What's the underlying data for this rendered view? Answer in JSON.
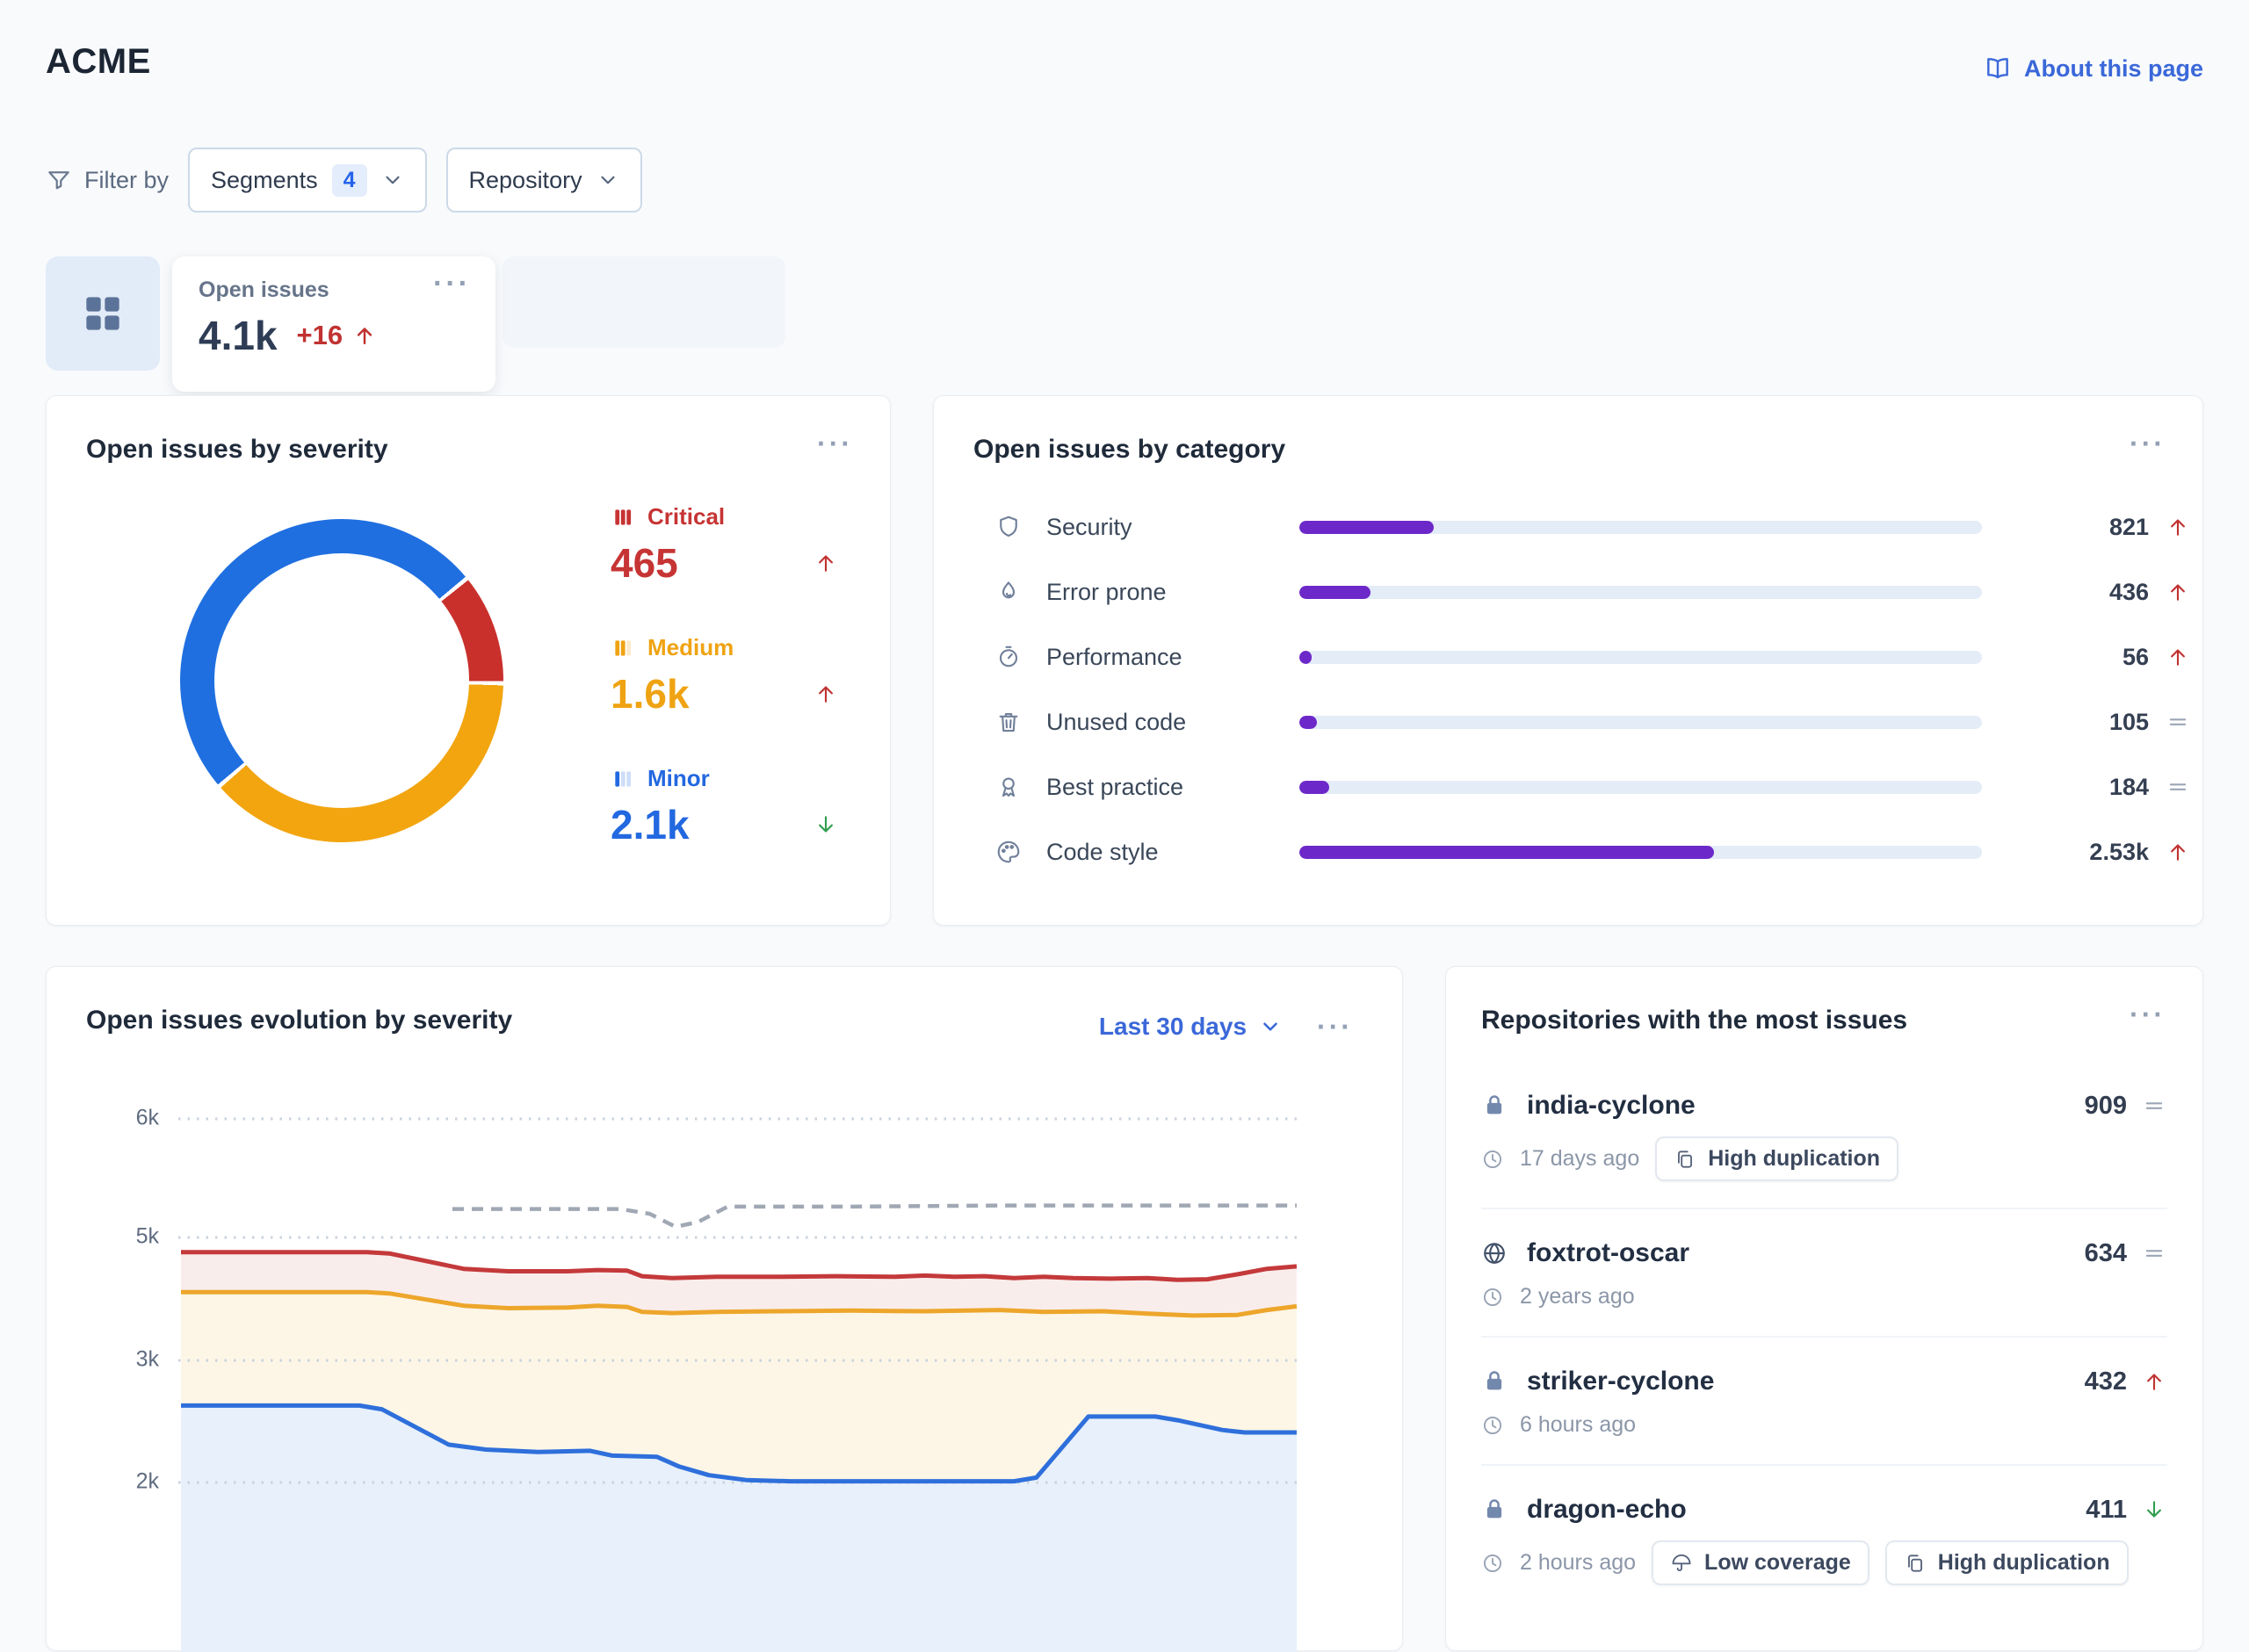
{
  "header": {
    "title": "ACME",
    "about_label": "About this page"
  },
  "icons_glyphs": {
    "more_menu": "···"
  },
  "colors": {
    "accent_blue": "#3b68d9",
    "purple_bar": "#6d28c9",
    "bar_track": "#e3ecf7",
    "critical_red": "#c63434",
    "medium_orange": "#efa312",
    "minor_blue": "#2268e0",
    "trend_up_red": "#c03231",
    "trend_down_green": "#2f9e4f",
    "trend_flat_gray": "#9aa5b5",
    "donut_blue": "#1f6fe0",
    "donut_red": "#c9302c",
    "donut_orange": "#f2a50f"
  },
  "filter": {
    "label": "Filter by",
    "segments_label": "Segments",
    "segments_count": "4",
    "repository_label": "Repository"
  },
  "metrics_strip": {
    "card": {
      "label": "Open issues",
      "value": "4.1k",
      "delta": "+16",
      "trend": "up"
    }
  },
  "severity_card": {
    "title": "Open issues by severity",
    "items": [
      {
        "label": "Critical",
        "value": "465",
        "trend": "up",
        "color": "#c63434",
        "icon": "severity-critical"
      },
      {
        "label": "Medium",
        "value": "1.6k",
        "trend": "up",
        "color": "#efa312",
        "icon": "severity-medium"
      },
      {
        "label": "Minor",
        "value": "2.1k",
        "trend": "down",
        "color": "#2268e0",
        "icon": "severity-minor"
      }
    ]
  },
  "category_card": {
    "title": "Open issues by category",
    "rows": [
      {
        "icon": "shield",
        "label": "Security",
        "value": "821",
        "trend": "up"
      },
      {
        "icon": "flame",
        "label": "Error prone",
        "value": "436",
        "trend": "up"
      },
      {
        "icon": "stopwatch",
        "label": "Performance",
        "value": "56",
        "trend": "up"
      },
      {
        "icon": "trash",
        "label": "Unused code",
        "value": "105",
        "trend": "flat"
      },
      {
        "icon": "medal",
        "label": "Best practice",
        "value": "184",
        "trend": "flat"
      },
      {
        "icon": "palette",
        "label": "Code style",
        "value": "2.53k",
        "trend": "up"
      }
    ]
  },
  "evolution_card": {
    "title": "Open issues evolution by severity",
    "range_label": "Last 30 days"
  },
  "repos_card": {
    "title": "Repositories with the most issues",
    "rows": [
      {
        "icon": "lock",
        "name": "india-cyclone",
        "value": "909",
        "trend": "flat",
        "updated": "17 days ago",
        "badges": [
          {
            "icon": "copy",
            "label": "High duplication"
          }
        ]
      },
      {
        "icon": "globe",
        "name": "foxtrot-oscar",
        "value": "634",
        "trend": "flat",
        "updated": "2 years ago",
        "badges": []
      },
      {
        "icon": "lock",
        "name": "striker-cyclone",
        "value": "432",
        "trend": "up",
        "updated": "6 hours ago",
        "badges": []
      },
      {
        "icon": "lock",
        "name": "dragon-echo",
        "value": "411",
        "trend": "down",
        "updated": "2 hours ago",
        "badges": [
          {
            "icon": "umbrella",
            "label": "Low coverage"
          },
          {
            "icon": "copy",
            "label": "High duplication"
          }
        ]
      }
    ]
  },
  "chart_data": [
    {
      "type": "pie",
      "donut": true,
      "title": "Open issues by severity",
      "labels": [
        "Critical",
        "Medium",
        "Minor"
      ],
      "values": [
        465,
        1600,
        2100
      ],
      "display_values": [
        "465",
        "1.6k",
        "2.1k"
      ],
      "colors": [
        "#c9302c",
        "#f2a50f",
        "#1f6fe0"
      ],
      "trends": [
        "up",
        "up",
        "down"
      ],
      "draw_order_from_230deg_clockwise": [
        "Minor",
        "Critical",
        "Medium"
      ],
      "segment_gap_deg": 1.5
    },
    {
      "type": "bar",
      "orientation": "horizontal",
      "title": "Open issues by category",
      "categories": [
        "Security",
        "Error prone",
        "Performance",
        "Unused code",
        "Best practice",
        "Code style"
      ],
      "values": [
        821,
        436,
        56,
        105,
        184,
        2530
      ],
      "display_values": [
        "821",
        "436",
        "56",
        "105",
        "184",
        "2.53k"
      ],
      "trends": [
        "up",
        "up",
        "up",
        "flat",
        "flat",
        "up"
      ],
      "scale_total": 4165,
      "bar_color": "#6d28c9",
      "track_color": "#e3ecf7",
      "grid": false
    },
    {
      "type": "area",
      "title": "Open issues evolution by severity",
      "x_unit": "days ago (0 = 30 days ago, 30 = today)",
      "x_range": [
        0,
        30
      ],
      "range_label": "Last 30 days",
      "yticks": [
        {
          "label": "6k",
          "value": 6
        },
        {
          "label": "5k",
          "value": 5
        },
        {
          "label": "3k",
          "value": 3
        },
        {
          "label": "2k",
          "value": 2
        }
      ],
      "grid": "dotted",
      "series": [
        {
          "name": "total-threshold",
          "style": "dashed",
          "color": "#a0a8b4",
          "fill": null,
          "points": [
            [
              7.3,
              5.24
            ],
            [
              11.8,
              5.24
            ],
            [
              12.6,
              5.2
            ],
            [
              13.3,
              5.09
            ],
            [
              13.9,
              5.13
            ],
            [
              14.7,
              5.26
            ],
            [
              18,
              5.26
            ],
            [
              22,
              5.27
            ],
            [
              26,
              5.27
            ],
            [
              30,
              5.27
            ]
          ]
        },
        {
          "name": "critical-cumulative-top",
          "style": "solid",
          "color": "#c4393a",
          "fill": "#f9edec",
          "points": [
            [
              0,
              4.76
            ],
            [
              5,
              4.76
            ],
            [
              5.6,
              4.74
            ],
            [
              7.6,
              4.49
            ],
            [
              8.8,
              4.45
            ],
            [
              10.4,
              4.45
            ],
            [
              11.2,
              4.47
            ],
            [
              12,
              4.46
            ],
            [
              12.4,
              4.37
            ],
            [
              13.2,
              4.34
            ],
            [
              14.4,
              4.36
            ],
            [
              16,
              4.36
            ],
            [
              17.6,
              4.37
            ],
            [
              19.2,
              4.36
            ],
            [
              20,
              4.38
            ],
            [
              20.8,
              4.36
            ],
            [
              21.6,
              4.37
            ],
            [
              22.4,
              4.34
            ],
            [
              23.2,
              4.36
            ],
            [
              24,
              4.34
            ],
            [
              25,
              4.33
            ],
            [
              26,
              4.34
            ],
            [
              26.8,
              4.31
            ],
            [
              27.6,
              4.32
            ],
            [
              28.4,
              4.4
            ],
            [
              29.2,
              4.49
            ],
            [
              30,
              4.53
            ]
          ]
        },
        {
          "name": "medium-cumulative",
          "style": "solid",
          "color": "#eda62b",
          "fill": "#fdf6e7",
          "points": [
            [
              0,
              4.11
            ],
            [
              5,
              4.11
            ],
            [
              5.6,
              4.09
            ],
            [
              7.6,
              3.89
            ],
            [
              8.8,
              3.85
            ],
            [
              10.4,
              3.86
            ],
            [
              11.2,
              3.89
            ],
            [
              12,
              3.87
            ],
            [
              12.4,
              3.79
            ],
            [
              13.2,
              3.77
            ],
            [
              14.4,
              3.79
            ],
            [
              16,
              3.8
            ],
            [
              18,
              3.81
            ],
            [
              20,
              3.8
            ],
            [
              22,
              3.82
            ],
            [
              23.2,
              3.79
            ],
            [
              24.8,
              3.8
            ],
            [
              26,
              3.76
            ],
            [
              27.2,
              3.73
            ],
            [
              28.4,
              3.74
            ],
            [
              29.2,
              3.82
            ],
            [
              30,
              3.88
            ]
          ]
        },
        {
          "name": "minor",
          "style": "solid",
          "color": "#2e6fdb",
          "fill": "#e7f0fb",
          "points": [
            [
              0,
              2.63
            ],
            [
              4.8,
              2.63
            ],
            [
              5.4,
              2.6
            ],
            [
              7.2,
              2.31
            ],
            [
              8.2,
              2.27
            ],
            [
              9.6,
              2.25
            ],
            [
              11,
              2.26
            ],
            [
              11.6,
              2.22
            ],
            [
              12.8,
              2.21
            ],
            [
              13.4,
              2.13
            ],
            [
              14.2,
              2.06
            ],
            [
              15.2,
              2.02
            ],
            [
              16.4,
              2.01
            ],
            [
              22.4,
              2.01
            ],
            [
              23,
              2.04
            ],
            [
              24.4,
              2.54
            ],
            [
              26.2,
              2.54
            ],
            [
              26.8,
              2.51
            ],
            [
              28,
              2.43
            ],
            [
              28.6,
              2.41
            ],
            [
              30,
              2.41
            ]
          ]
        }
      ],
      "legend": false
    }
  ]
}
